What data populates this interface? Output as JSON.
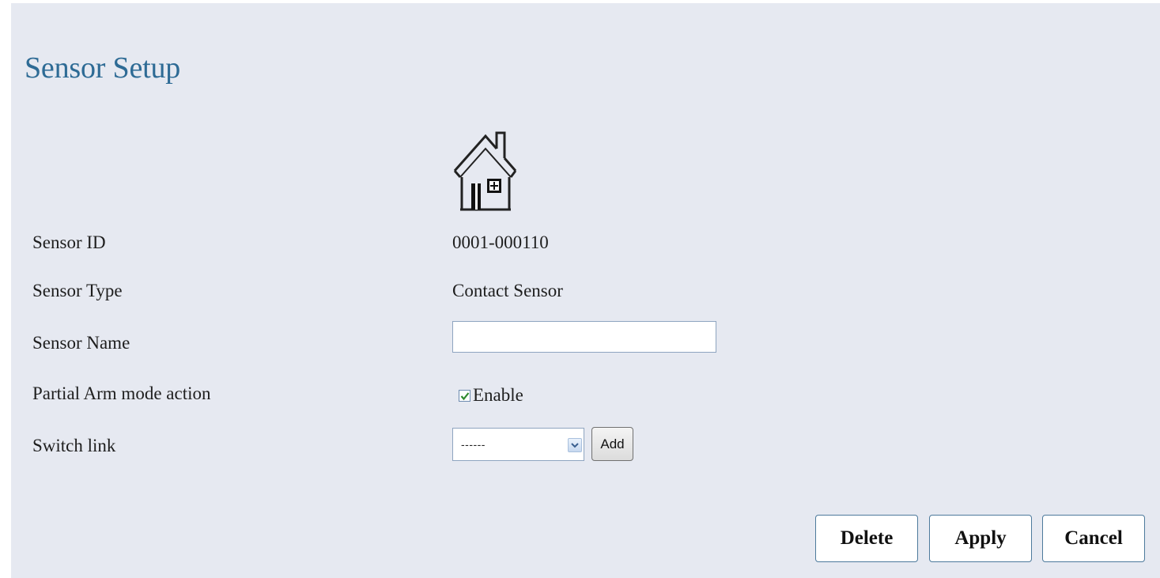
{
  "page": {
    "title": "Sensor Setup"
  },
  "icon": {
    "sensor_icon": "house-contact-sensor-icon"
  },
  "fields": {
    "sensor_id_label": "Sensor ID",
    "sensor_id_value": "0001-000110",
    "sensor_type_label": "Sensor Type",
    "sensor_type_value": "Contact Sensor",
    "sensor_name_label": "Sensor Name",
    "sensor_name_value": "",
    "partial_arm_label": "Partial Arm mode action",
    "partial_arm_enable_label": "Enable",
    "partial_arm_checked": true,
    "switch_link_label": "Switch link",
    "switch_link_selected": "------",
    "switch_link_add_label": "Add"
  },
  "actions": {
    "delete_label": "Delete",
    "apply_label": "Apply",
    "cancel_label": "Cancel"
  },
  "colors": {
    "panel_background": "#e6e9f1",
    "title_color": "#2e6b95",
    "button_border": "#4d7a9c",
    "checkbox_check": "#2f8a2f"
  }
}
